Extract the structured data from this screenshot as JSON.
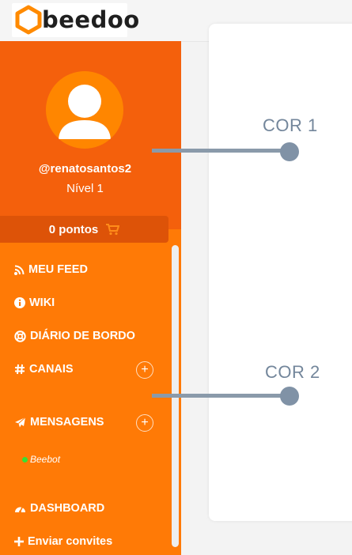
{
  "brand": {
    "name": "beedoo"
  },
  "profile": {
    "username": "@renatosantos2",
    "level": "Nível 1",
    "points": "0 pontos"
  },
  "nav": {
    "feed": "MEU FEED",
    "wiki": "WIKI",
    "diario": "DIÁRIO DE BORDO",
    "canais": "CANAIS",
    "mensagens": "MENSAGENS",
    "beebot": "Beebot",
    "dashboard": "DASHBOARD",
    "convites": "Enviar convites"
  },
  "annotations": {
    "cor1": "COR 1",
    "cor2": "COR 2"
  },
  "colors": {
    "sidebar_primary": "#ff7a06",
    "profile_header": "#f4600c",
    "points_bar": "#dd5308",
    "annotation": "#73869b",
    "online_status": "#36e035"
  },
  "icons": [
    "hexagon-logo-icon",
    "avatar-icon",
    "cart-icon",
    "rss-icon",
    "info-icon",
    "lifebuoy-icon",
    "hashtag-icon",
    "paper-plane-icon",
    "gauge-icon",
    "plus-icon"
  ]
}
